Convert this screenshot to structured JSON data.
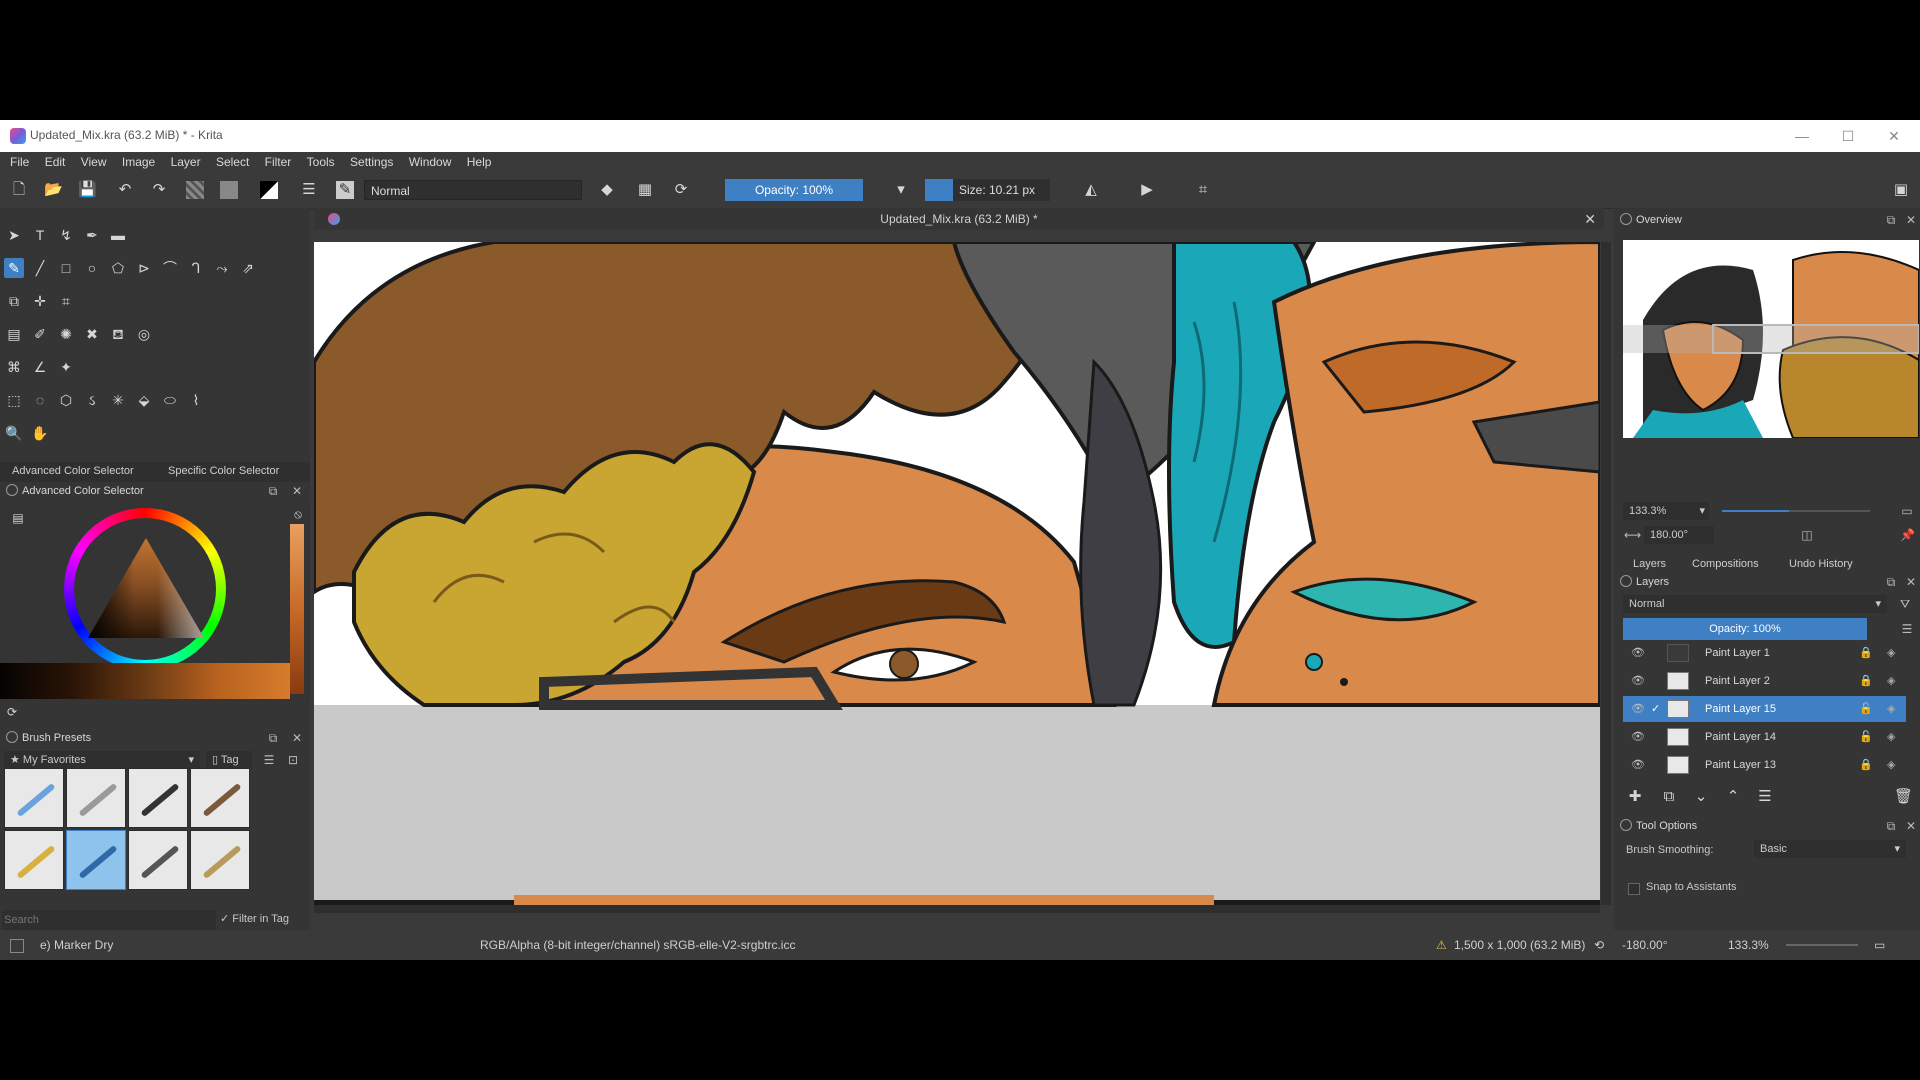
{
  "window": {
    "title": "Updated_Mix.kra (63.2 MiB) * - Krita",
    "minimize": "—",
    "maximize": "☐",
    "close": "✕"
  },
  "menu": [
    "File",
    "Edit",
    "View",
    "Image",
    "Layer",
    "Select",
    "Filter",
    "Tools",
    "Settings",
    "Window",
    "Help"
  ],
  "toolbar": {
    "blend_mode": "Normal",
    "opacity": "Opacity: 100%",
    "size": "Size: 10.21 px"
  },
  "document": {
    "tab_title": "Updated_Mix.kra (63.2 MiB) *",
    "close": "✕"
  },
  "left_docker": {
    "tabs": [
      "Advanced Color Selector",
      "Specific Color Selector"
    ],
    "color_selector_title": "Advanced Color Selector",
    "brush_presets_title": "Brush Presets",
    "brush_tag": "My Favorites",
    "tag_button": "Tag",
    "search_placeholder": "Search",
    "filter_in_tag": "Filter in Tag"
  },
  "right_docker": {
    "overview_title": "Overview",
    "zoom": "133.3%",
    "rotation": "180.00°",
    "tabs": [
      "Layers",
      "Compositions",
      "Undo History"
    ],
    "layers_title": "Layers",
    "layer_blend": "Normal",
    "layer_opacity": "Opacity: 100%",
    "layers": [
      {
        "name": "Paint Layer 1",
        "active": false
      },
      {
        "name": "Paint Layer 2",
        "active": false
      },
      {
        "name": "Paint Layer 15",
        "active": true
      },
      {
        "name": "Paint Layer 14",
        "active": false
      },
      {
        "name": "Paint Layer 13",
        "active": false
      }
    ],
    "tool_options_title": "Tool Options",
    "brush_smoothing_label": "Brush Smoothing:",
    "brush_smoothing_value": "Basic",
    "snap_to_assistants": "Snap to Assistants"
  },
  "statusbar": {
    "brush": "e) Marker Dry",
    "color_info": "RGB/Alpha (8-bit integer/channel)  sRGB-elle-V2-srgbtrc.icc",
    "dimensions": "1,500 x 1,000 (63.2 MiB)",
    "rotation": "-180.00°",
    "zoom": "133.3%"
  },
  "colors": {
    "accent": "#3f7fc4",
    "panel": "#353535",
    "skin": "#d9894a",
    "hair_brown": "#8a5a2b",
    "hair_yellow": "#c9a531",
    "teal": "#1aa8b8"
  }
}
